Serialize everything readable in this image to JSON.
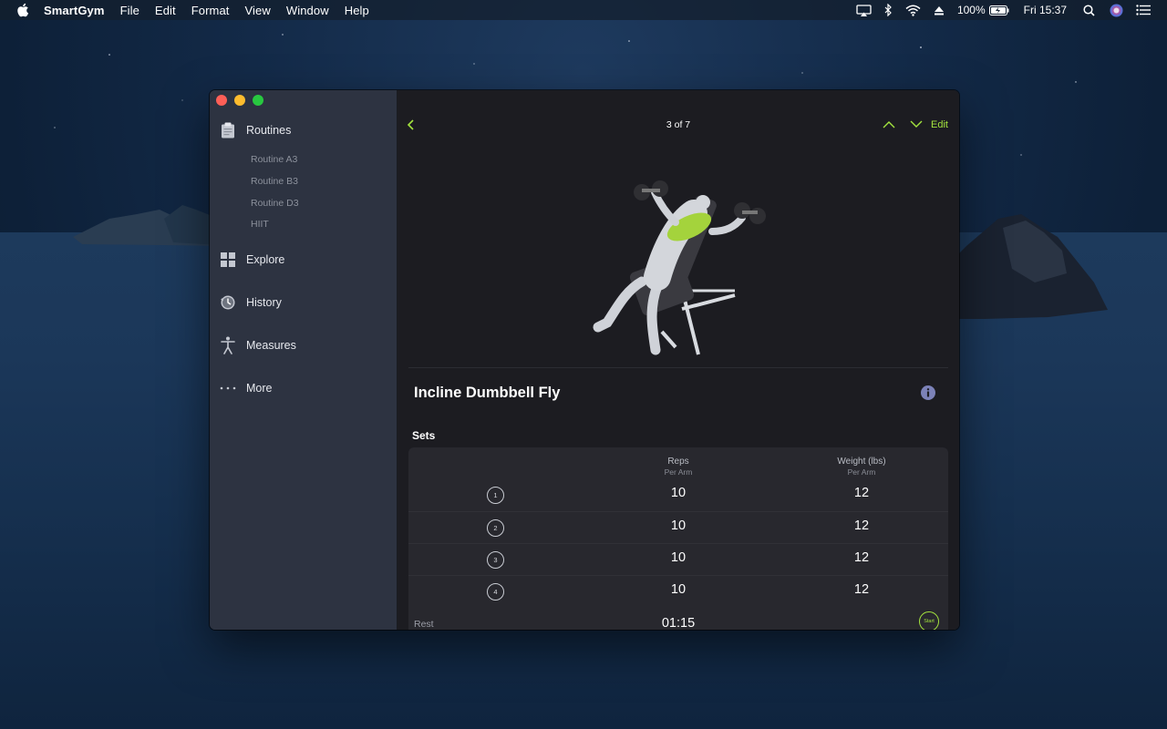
{
  "menubar": {
    "app_name": "SmartGym",
    "menus": [
      "File",
      "Edit",
      "Format",
      "View",
      "Window",
      "Help"
    ],
    "battery": "100%",
    "clock": "Fri 15:37"
  },
  "sidebar": {
    "routines_label": "Routines",
    "routines": [
      "Routine A3",
      "Routine B3",
      "Routine D3",
      "HIIT"
    ],
    "explore_label": "Explore",
    "history_label": "History",
    "measures_label": "Measures",
    "more_label": "More"
  },
  "toolbar": {
    "counter": "3 of 7",
    "edit_label": "Edit"
  },
  "exercise": {
    "name": "Incline Dumbbell Fly"
  },
  "sets": {
    "label": "Sets",
    "reps_header": "Reps",
    "reps_sub": "Per Arm",
    "weight_header": "Weight (lbs)",
    "weight_sub": "Per Arm",
    "rows": [
      {
        "num": "1",
        "reps": "10",
        "weight": "12"
      },
      {
        "num": "2",
        "reps": "10",
        "weight": "12"
      },
      {
        "num": "3",
        "reps": "10",
        "weight": "12"
      },
      {
        "num": "4",
        "reps": "10",
        "weight": "12"
      }
    ],
    "rest_label": "Rest",
    "rest_time": "01:15",
    "start_label": "Start"
  },
  "colors": {
    "accent": "#a4e43e",
    "sidebar_bg": "#2d3341",
    "main_bg": "#1c1c21",
    "card_bg": "#28282e"
  }
}
